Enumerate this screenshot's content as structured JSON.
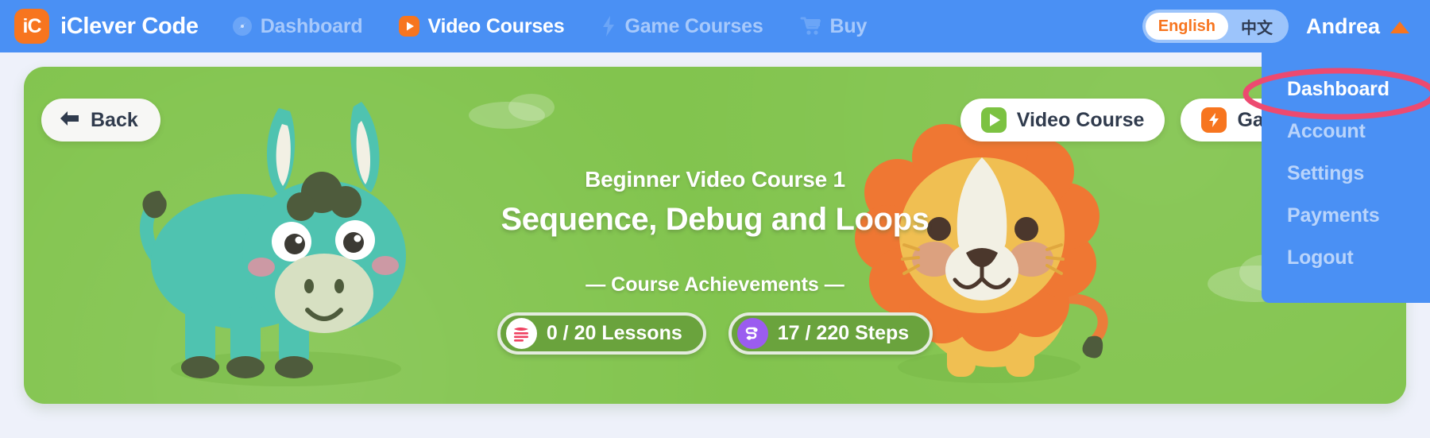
{
  "navbar": {
    "logo_text": "iC",
    "brand": "iClever Code",
    "items": [
      {
        "label": "Dashboard",
        "icon": "gauge-icon",
        "active": false
      },
      {
        "label": "Video Courses",
        "icon": "play-icon",
        "active": true
      },
      {
        "label": "Game Courses",
        "icon": "bolt-icon",
        "active": false
      },
      {
        "label": "Buy",
        "icon": "cart-icon",
        "active": false
      }
    ],
    "language": {
      "options": [
        "English",
        "中文"
      ],
      "selected": "English"
    },
    "user": {
      "name": "Andrea",
      "caret": "caret-up-icon"
    }
  },
  "dropdown": {
    "items": [
      {
        "label": "Dashboard",
        "selected": true
      },
      {
        "label": "Account",
        "selected": false
      },
      {
        "label": "Settings",
        "selected": false
      },
      {
        "label": "Payments",
        "selected": false
      },
      {
        "label": "Logout",
        "selected": false
      }
    ],
    "annotation": "red-ellipse-highlight"
  },
  "hero": {
    "back_label": "Back",
    "actions": [
      {
        "label": "Video Course",
        "icon": "play-icon"
      },
      {
        "label": "Game Course",
        "icon": "bolt-icon"
      }
    ],
    "kicker": "Beginner Video Course 1",
    "title": "Sequence, Debug and Loops",
    "achievements_label": "— Course Achievements —",
    "badges": [
      {
        "value": "0 / 20 Lessons",
        "icon": "lessons-icon"
      },
      {
        "value": "17 / 220 Steps",
        "icon": "steps-icon"
      }
    ]
  },
  "colors": {
    "nav_blue": "#4a90f4",
    "brand_orange": "#f7751f",
    "hero_green": "#82c44e",
    "badge_green": "#6aa33d",
    "annotation_pink": "#ed4a70",
    "page_bg": "#eef1fa",
    "steps_purple": "#9b5cf0",
    "lessons_pink": "#ef4060"
  }
}
